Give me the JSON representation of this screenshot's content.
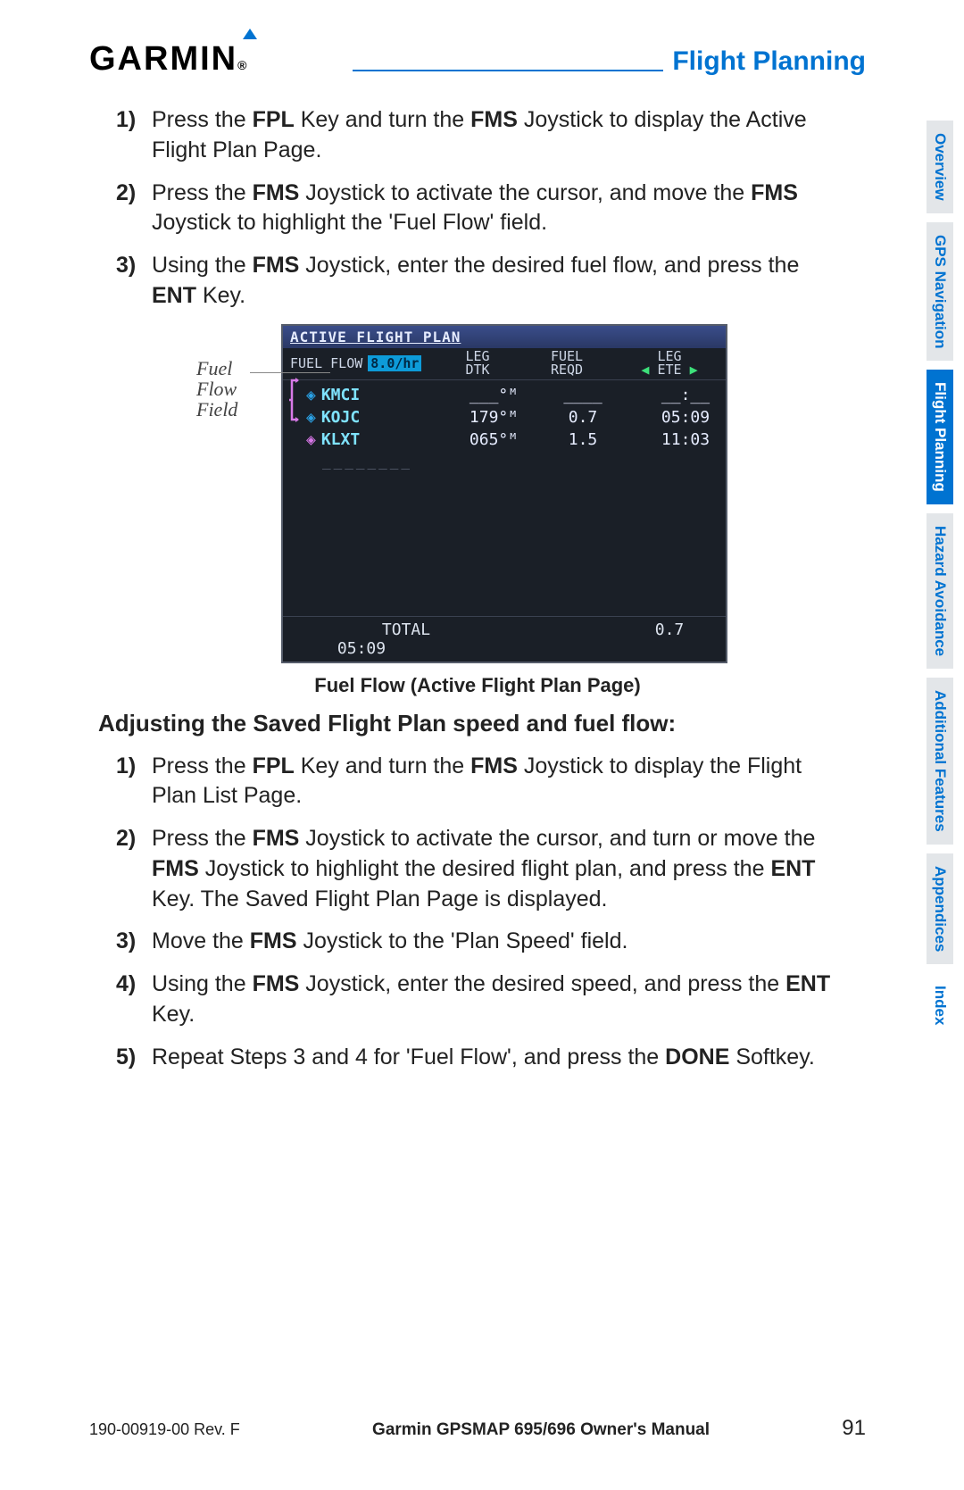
{
  "header": {
    "logo": "GARMIN",
    "section": "Flight Planning"
  },
  "steps_a": [
    {
      "n": "1)",
      "parts": [
        "Press the ",
        "FPL",
        " Key and turn the ",
        "FMS",
        " Joystick to display the Active Flight Plan Page."
      ]
    },
    {
      "n": "2)",
      "parts": [
        "Press the ",
        "FMS",
        " Joystick to activate the cursor, and move the ",
        "FMS",
        " Joystick to highlight the 'Fuel Flow' field."
      ]
    },
    {
      "n": "3)",
      "parts": [
        "Using the ",
        "FMS",
        " Joystick, enter the desired fuel flow, and press the ",
        "ENT",
        " Key."
      ]
    }
  ],
  "callout": "Fuel\nFlow\nField",
  "screen": {
    "title": "ACTIVE FLIGHT PLAN",
    "fuel_flow_label": "FUEL FLOW",
    "fuel_flow_value": "8.0/hr",
    "cols": {
      "leg_dtk": "LEG\nDTK",
      "fuel_reqd": "FUEL\nREQD",
      "leg_ete": "LEG\nETE"
    },
    "waypoints": [
      {
        "id": "KMCI",
        "dtk": "___°ᴹ",
        "fuel": "____",
        "ete": "__:__",
        "mag": false
      },
      {
        "id": "KOJC",
        "dtk": "179°ᴹ",
        "fuel": "0.7",
        "ete": "05:09",
        "mag": false
      },
      {
        "id": "KLXT",
        "dtk": "065°ᴹ",
        "fuel": "1.5",
        "ete": "11:03",
        "mag": true
      }
    ],
    "placeholder": "________",
    "total_label": "TOTAL",
    "total_fuel": "0.7",
    "total_ete": "05:09"
  },
  "caption": "Fuel Flow (Active Flight Plan Page)",
  "subhead": "Adjusting the Saved Flight Plan speed and fuel flow:",
  "steps_b": [
    {
      "n": "1)",
      "parts": [
        "Press the ",
        "FPL",
        " Key and turn the ",
        "FMS",
        " Joystick to display the Flight Plan List Page."
      ]
    },
    {
      "n": "2)",
      "parts": [
        "Press the ",
        "FMS",
        " Joystick to activate the cursor, and turn or move the ",
        "FMS",
        " Joystick to highlight the desired flight plan, and press the ",
        "ENT",
        " Key.  The Saved Flight Plan Page is displayed."
      ]
    },
    {
      "n": "3)",
      "parts": [
        "Move the ",
        "FMS",
        " Joystick to the 'Plan Speed' field."
      ]
    },
    {
      "n": "4)",
      "parts": [
        "Using the ",
        "FMS",
        " Joystick, enter the desired speed, and press the ",
        "ENT",
        " Key."
      ]
    },
    {
      "n": "5)",
      "parts": [
        "Repeat Steps 3 and 4 for 'Fuel Flow', and press the ",
        "DONE",
        " Softkey."
      ]
    }
  ],
  "tabs": [
    {
      "label": "Overview",
      "active": false,
      "bg": true
    },
    {
      "label": "GPS Navigation",
      "active": false,
      "bg": true
    },
    {
      "label": "Flight Planning",
      "active": true,
      "bg": true
    },
    {
      "label": "Hazard Avoidance",
      "active": false,
      "bg": true
    },
    {
      "label": "Additional Features",
      "active": false,
      "bg": true
    },
    {
      "label": "Appendices",
      "active": false,
      "bg": true
    },
    {
      "label": "Index",
      "active": false,
      "bg": false
    }
  ],
  "footer": {
    "rev": "190-00919-00 Rev. F",
    "title": "Garmin GPSMAP 695/696 Owner's Manual",
    "page": "91"
  }
}
